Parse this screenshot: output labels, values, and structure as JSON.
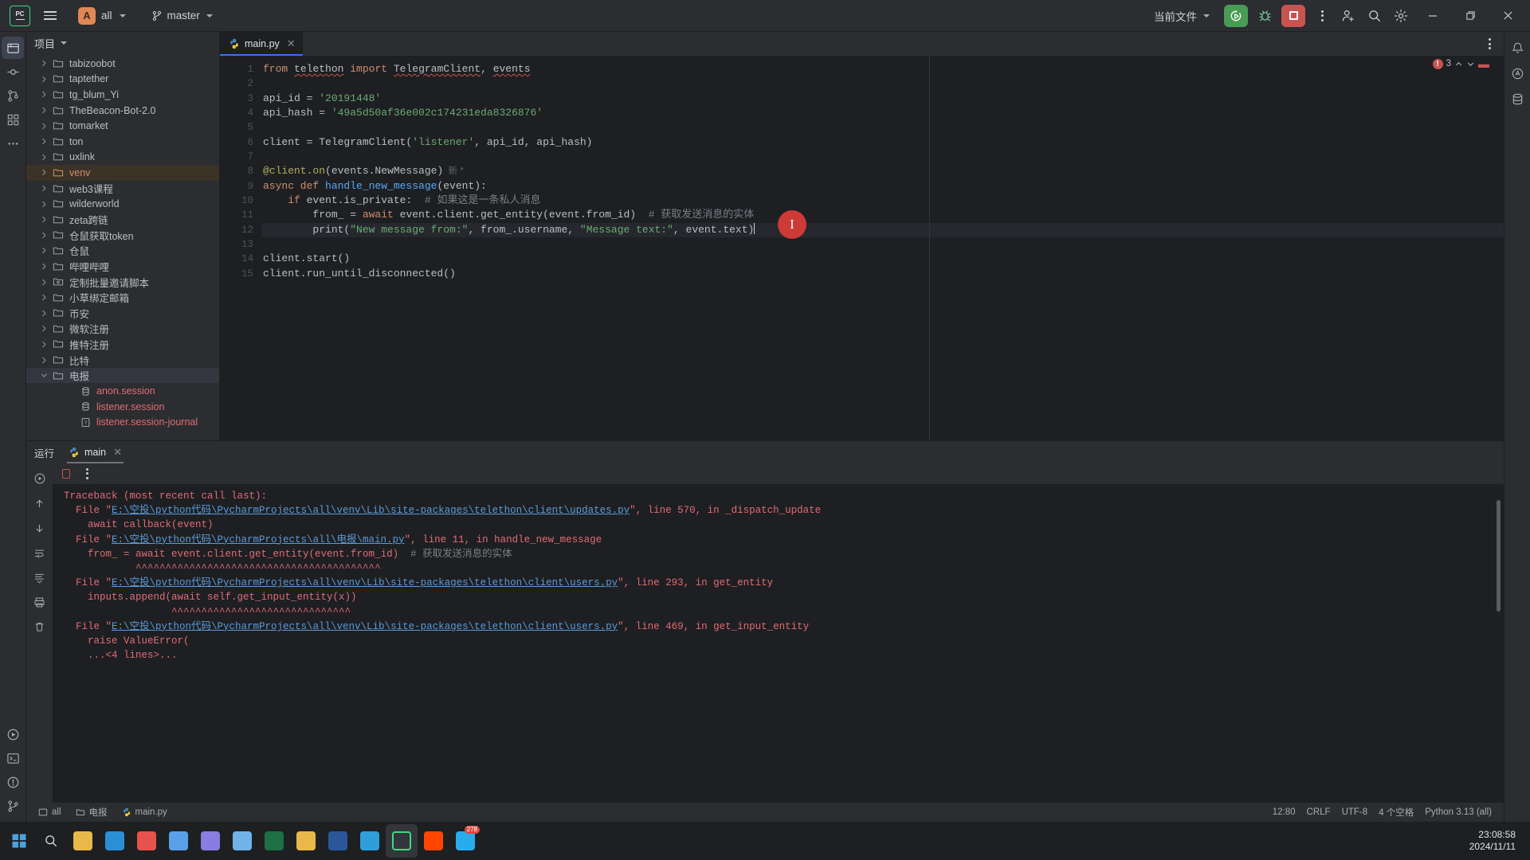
{
  "titlebar": {
    "app_icon": "pycharm-logo",
    "menu_icon": "hamburger-menu-icon",
    "project_badge": "A",
    "project_name": "all",
    "vcs_icon": "git-branch-icon",
    "vcs_branch": "master",
    "run_config": "当前文件",
    "run_icon": "run-button",
    "debug_icon": "debug-bug-icon",
    "stop_icon": "stop-button",
    "more_icon": "more-vertical-icon",
    "account_icon": "add-user-icon",
    "search_icon": "search-icon",
    "settings_icon": "settings-gear-icon",
    "minimize": "minimize-icon",
    "maximize": "maximize-icon",
    "close": "close-icon"
  },
  "left_rail": {
    "items": [
      "project-tool-icon",
      "commit-tool-icon",
      "pull-requests-icon",
      "structure-icon",
      "more-tools-icon"
    ],
    "bottom": [
      "terminal-icon",
      "problems-icon",
      "git-icon"
    ]
  },
  "right_rail": {
    "items": [
      "notifications-bell-icon",
      "ai-assistant-icon",
      "database-icon"
    ]
  },
  "project_panel": {
    "title": "项目",
    "chevron": "chevron-down-icon",
    "tree": [
      {
        "label": "tabizoobot",
        "icon": "folder-icon",
        "indent": 1,
        "arrow": true,
        "state": "normal"
      },
      {
        "label": "taptether",
        "icon": "folder-icon",
        "indent": 1,
        "arrow": true,
        "state": "normal"
      },
      {
        "label": "tg_blum_Yi",
        "icon": "folder-icon",
        "indent": 1,
        "arrow": true,
        "state": "normal"
      },
      {
        "label": "TheBeacon-Bot-2.0",
        "icon": "folder-icon",
        "indent": 1,
        "arrow": true,
        "state": "normal"
      },
      {
        "label": "tomarket",
        "icon": "folder-icon",
        "indent": 1,
        "arrow": true,
        "state": "normal"
      },
      {
        "label": "ton",
        "icon": "folder-icon",
        "indent": 1,
        "arrow": true,
        "state": "normal"
      },
      {
        "label": "uxlink",
        "icon": "folder-icon",
        "indent": 1,
        "arrow": true,
        "state": "normal"
      },
      {
        "label": "venv",
        "icon": "folder-excluded-icon",
        "indent": 1,
        "arrow": true,
        "state": "selected-orange"
      },
      {
        "label": "web3课程",
        "icon": "folder-icon",
        "indent": 1,
        "arrow": true,
        "state": "normal"
      },
      {
        "label": "wilderworld",
        "icon": "folder-icon",
        "indent": 1,
        "arrow": true,
        "state": "normal"
      },
      {
        "label": "zeta跨链",
        "icon": "folder-icon",
        "indent": 1,
        "arrow": true,
        "state": "normal"
      },
      {
        "label": "仓鼠获取token",
        "icon": "folder-icon",
        "indent": 1,
        "arrow": true,
        "state": "normal"
      },
      {
        "label": "仓鼠",
        "icon": "folder-icon",
        "indent": 1,
        "arrow": true,
        "state": "normal"
      },
      {
        "label": "哔哩哔哩",
        "icon": "folder-icon",
        "indent": 1,
        "arrow": true,
        "state": "normal"
      },
      {
        "label": "定制批量邀请脚本",
        "icon": "module-folder-icon",
        "indent": 1,
        "arrow": true,
        "state": "normal"
      },
      {
        "label": "小草绑定邮箱",
        "icon": "folder-icon",
        "indent": 1,
        "arrow": true,
        "state": "normal"
      },
      {
        "label": "币安",
        "icon": "folder-icon",
        "indent": 1,
        "arrow": true,
        "state": "normal"
      },
      {
        "label": "微软注册",
        "icon": "folder-icon",
        "indent": 1,
        "arrow": true,
        "state": "normal"
      },
      {
        "label": "推特注册",
        "icon": "folder-icon",
        "indent": 1,
        "arrow": true,
        "state": "normal"
      },
      {
        "label": "比特",
        "icon": "folder-icon",
        "indent": 1,
        "arrow": true,
        "state": "normal"
      },
      {
        "label": "电报",
        "icon": "folder-icon",
        "indent": 1,
        "arrow": true,
        "state": "selected-blue",
        "expanded": true
      },
      {
        "label": "anon.session",
        "icon": "database-file-icon",
        "indent": 2,
        "arrow": false,
        "state": "file-pink"
      },
      {
        "label": "listener.session",
        "icon": "database-file-icon",
        "indent": 2,
        "arrow": false,
        "state": "file-pink"
      },
      {
        "label": "listener.session-journal",
        "icon": "unknown-file-icon",
        "indent": 2,
        "arrow": false,
        "state": "file-pink"
      }
    ]
  },
  "editor": {
    "tab": {
      "label": "main.py",
      "icon": "python-file-icon",
      "close": "close-tab-icon"
    },
    "tab_options_icon": "editor-options-icon",
    "inspection": {
      "count": "3",
      "error_icon": "error-circle-icon",
      "up": "chevron-up-icon",
      "down": "chevron-down-icon"
    },
    "cursor_overlay": "text-cursor-indicator",
    "line_numbers": [
      "1",
      "2",
      "3",
      "4",
      "5",
      "6",
      "7",
      "8",
      "9",
      "10",
      "11",
      "12",
      "13",
      "14",
      "15"
    ],
    "code_lines": [
      {
        "n": 1,
        "segments": [
          {
            "t": "from ",
            "c": "kw"
          },
          {
            "t": "telethon",
            "c": "wavy"
          },
          {
            "t": " import ",
            "c": "kw"
          },
          {
            "t": "TelegramClient",
            "c": "wavy"
          },
          {
            "t": ", ",
            "c": ""
          },
          {
            "t": "events",
            "c": "wavy"
          }
        ]
      },
      {
        "n": 2,
        "segments": []
      },
      {
        "n": 3,
        "segments": [
          {
            "t": "api_id = ",
            "c": ""
          },
          {
            "t": "'20191448'",
            "c": "str"
          }
        ]
      },
      {
        "n": 4,
        "segments": [
          {
            "t": "api_hash = ",
            "c": ""
          },
          {
            "t": "'49a5d50af36e002c174231eda8326876'",
            "c": "str"
          }
        ]
      },
      {
        "n": 5,
        "segments": []
      },
      {
        "n": 6,
        "segments": [
          {
            "t": "client = TelegramClient(",
            "c": ""
          },
          {
            "t": "'listener'",
            "c": "str"
          },
          {
            "t": ", api_id, api_hash)",
            "c": ""
          }
        ]
      },
      {
        "n": 7,
        "segments": []
      },
      {
        "n": 8,
        "segments": [
          {
            "t": "@client.on",
            "c": "dec"
          },
          {
            "t": "(events.NewMessage)",
            "c": ""
          },
          {
            "t": "  新 *",
            "c": "hint"
          }
        ]
      },
      {
        "n": 9,
        "segments": [
          {
            "t": "async def ",
            "c": "kw"
          },
          {
            "t": "handle_new_message",
            "c": "fn"
          },
          {
            "t": "(event):",
            "c": ""
          }
        ]
      },
      {
        "n": 10,
        "segments": [
          {
            "t": "    if ",
            "c": "kw"
          },
          {
            "t": "event.is_private:  ",
            "c": ""
          },
          {
            "t": "# 如果这是一条私人消息",
            "c": "cmt"
          }
        ]
      },
      {
        "n": 11,
        "segments": [
          {
            "t": "        from_ = ",
            "c": ""
          },
          {
            "t": "await ",
            "c": "kw"
          },
          {
            "t": "event.client.get_entity(event.from_id)  ",
            "c": ""
          },
          {
            "t": "# 获取发送消息的实体",
            "c": "cmt"
          }
        ]
      },
      {
        "n": 12,
        "segments": [
          {
            "t": "        print(",
            "c": ""
          },
          {
            "t": "\"New message from:\"",
            "c": "str"
          },
          {
            "t": ", from_.username, ",
            "c": ""
          },
          {
            "t": "\"Message text:\"",
            "c": "str"
          },
          {
            "t": ", event.text)",
            "c": ""
          }
        ],
        "current": true
      },
      {
        "n": 13,
        "segments": []
      },
      {
        "n": 14,
        "segments": [
          {
            "t": "client.start()",
            "c": ""
          }
        ]
      },
      {
        "n": 15,
        "segments": [
          {
            "t": "client.run_until_disconnected()",
            "c": ""
          }
        ]
      }
    ]
  },
  "run_panel": {
    "label": "运行",
    "tab": {
      "label": "main",
      "icon": "python-run-icon",
      "close": "close-icon"
    },
    "toolbar": {
      "rerun_icon": "rerun-icon",
      "stop_icon": "stop-icon",
      "more_icon": "more-vertical-icon"
    },
    "side_icons": [
      "run-icon",
      "up-arrow-icon",
      "down-arrow-icon",
      "soft-wrap-icon",
      "scroll-end-icon",
      "print-icon",
      "trash-icon"
    ],
    "console_lines": [
      {
        "parts": [
          {
            "t": "Traceback (most recent call last):",
            "c": "err"
          }
        ]
      },
      {
        "parts": [
          {
            "t": "  File \"",
            "c": "err"
          },
          {
            "t": "E:\\空投\\python代码\\PycharmProjects\\all\\venv\\Lib\\site-packages\\telethon\\client\\updates.py",
            "c": "path"
          },
          {
            "t": "\", line 570, in _dispatch_update",
            "c": "err"
          }
        ]
      },
      {
        "parts": [
          {
            "t": "    await callback(event)",
            "c": "err"
          }
        ]
      },
      {
        "parts": [
          {
            "t": "  File \"",
            "c": "err"
          },
          {
            "t": "E:\\空投\\python代码\\PycharmProjects\\all\\电报\\main.py",
            "c": "path"
          },
          {
            "t": "\", line 11, in handle_new_message",
            "c": "err"
          }
        ]
      },
      {
        "parts": [
          {
            "t": "    from_ = await event.client.get_entity(event.from_id)  ",
            "c": "err"
          },
          {
            "t": "# 获取发送消息的实体",
            "c": "cmt"
          }
        ]
      },
      {
        "parts": [
          {
            "t": "            ^^^^^^^^^^^^^^^^^^^^^^^^^^^^^^^^^^^^^^^^^",
            "c": "carets"
          }
        ]
      },
      {
        "parts": [
          {
            "t": "  File \"",
            "c": "err"
          },
          {
            "t": "E:\\空投\\python代码\\PycharmProjects\\all\\venv\\Lib\\site-packages\\telethon\\client\\users.py",
            "c": "path"
          },
          {
            "t": "\", line 293, in get_entity",
            "c": "err"
          }
        ]
      },
      {
        "parts": [
          {
            "t": "    inputs.append(await self.get_input_entity(x))",
            "c": "err"
          }
        ]
      },
      {
        "parts": [
          {
            "t": "                  ^^^^^^^^^^^^^^^^^^^^^^^^^^^^^^",
            "c": "carets"
          }
        ]
      },
      {
        "parts": [
          {
            "t": "  File \"",
            "c": "err"
          },
          {
            "t": "E:\\空投\\python代码\\PycharmProjects\\all\\venv\\Lib\\site-packages\\telethon\\client\\users.py",
            "c": "path"
          },
          {
            "t": "\", line 469, in get_input_entity",
            "c": "err"
          }
        ]
      },
      {
        "parts": [
          {
            "t": "    raise ValueError(",
            "c": "err"
          }
        ]
      },
      {
        "parts": [
          {
            "t": "    ...<4 lines>...",
            "c": "err"
          }
        ]
      }
    ]
  },
  "statusbar": {
    "breadcrumb": [
      {
        "label": "all",
        "icon": "module-icon"
      },
      {
        "label": "电报",
        "icon": "folder-icon"
      },
      {
        "label": "main.py",
        "icon": "python-file-icon"
      }
    ],
    "position": "12:80",
    "line_sep": "CRLF",
    "encoding": "UTF-8",
    "indent": "4 个空格",
    "interpreter": "Python 3.13 (all)"
  },
  "taskbar": {
    "start": "windows-start-icon",
    "search": "search-icon",
    "apps": [
      {
        "name": "file-explorer-icon",
        "color": "#e8b84b"
      },
      {
        "name": "edge-browser-icon",
        "color": "#2a8fd6"
      },
      {
        "name": "chrome-browser-icon",
        "color": "#e5534b"
      },
      {
        "name": "app-grid-icon",
        "color": "#5aa0e8"
      },
      {
        "name": "bitcoin-app-icon",
        "color": "#8a7ce0"
      },
      {
        "name": "circle-app-icon",
        "color": "#6fb3e8"
      },
      {
        "name": "excel-icon",
        "color": "#1d7044"
      },
      {
        "name": "folder-app-icon",
        "color": "#e8b84b"
      },
      {
        "name": "word-icon",
        "color": "#2b579a"
      },
      {
        "name": "vscode-icon",
        "color": "#2f9fd9"
      },
      {
        "name": "pycharm-icon",
        "color": "#3ddb85",
        "selected": true
      },
      {
        "name": "reddit-icon",
        "color": "#ff4500"
      },
      {
        "name": "telegram-icon",
        "color": "#2aabee",
        "badge": "278"
      }
    ],
    "clock_time": "23:08:58",
    "clock_date": "2024/11/11"
  }
}
